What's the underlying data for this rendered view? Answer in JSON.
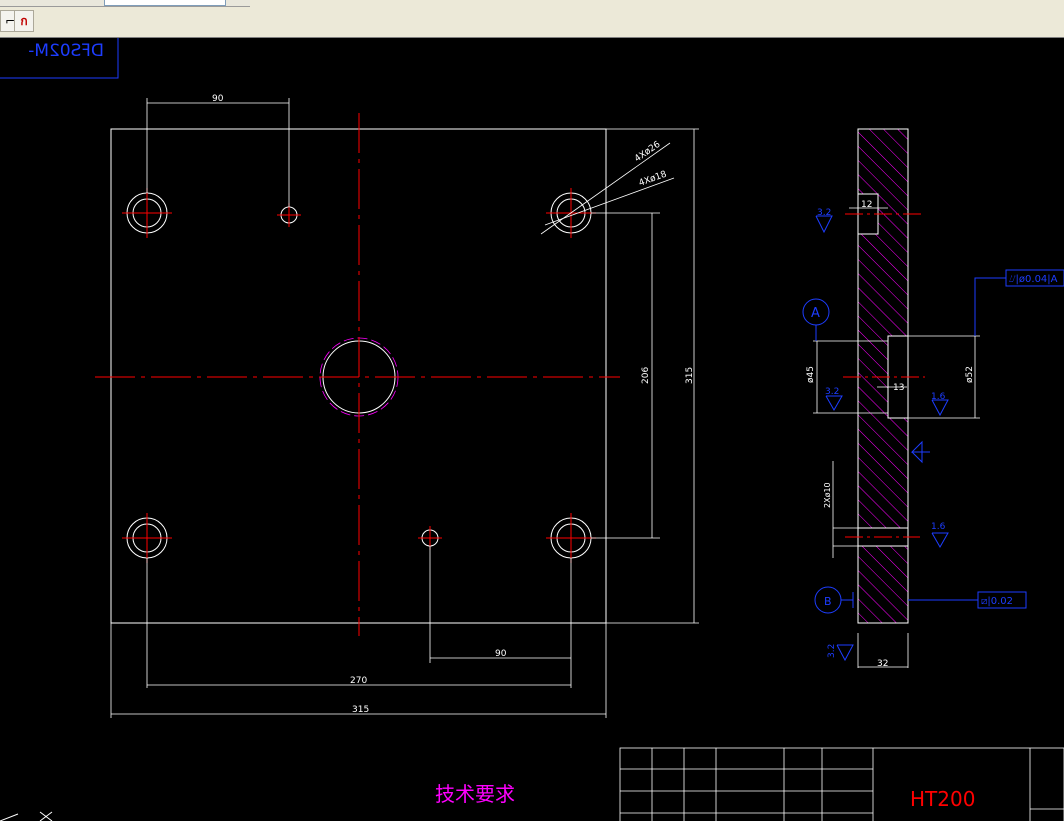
{
  "toolbar": {
    "buttons": [
      {
        "icon": "arrow-icon",
        "glyph": "⌐"
      },
      {
        "icon": "magnet-snap-icon",
        "glyph": "ก"
      }
    ]
  },
  "title_block_corner": {
    "text": "DFS02M-"
  },
  "front_view": {
    "dims": {
      "top_90": "90",
      "bottom_90": "90",
      "d270": "270",
      "d315_horizontal": "315",
      "d206": "206",
      "d315_vertical": "315",
      "hole_note_1": "4Xø26",
      "hole_note_2": "4Xø18"
    }
  },
  "side_view": {
    "dims": {
      "d12": "12",
      "d13": "13",
      "d32": "32",
      "d45": "ø45",
      "d52": "ø52",
      "hole_note": "2Xø10",
      "roughness_1": "3.2",
      "roughness_2": "3.2",
      "roughness_3": "1.6",
      "roughness_4": "1.6",
      "roughness_5": "3.2",
      "datum_a": "A",
      "datum_b": "B",
      "tolerance_top": "⌰|ø0.04|A",
      "tolerance_bottom": "⧄|0.02"
    }
  },
  "notes": {
    "technical_requirements": "技术要求"
  },
  "title_block": {
    "material": "HT200"
  },
  "colors": {
    "outline": "#ffffff",
    "centerline": "#ff0000",
    "dimension_text": "#ffffff",
    "annotation": "#1d3dff",
    "hatch": "#ff00ff",
    "note": "#ff00ff"
  }
}
